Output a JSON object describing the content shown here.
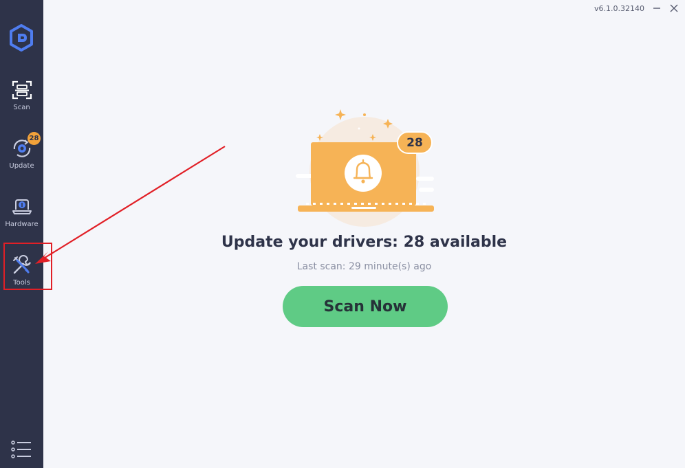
{
  "app": {
    "version": "v6.1.0.32140",
    "logo_icon": "driver-easy-logo",
    "minimize_icon": "minimize-icon",
    "close_icon": "close-icon"
  },
  "sidebar": {
    "items": [
      {
        "label": "Scan",
        "icon": "scan-icon"
      },
      {
        "label": "Update",
        "icon": "update-icon",
        "badge": "28"
      },
      {
        "label": "Hardware",
        "icon": "hardware-icon"
      },
      {
        "label": "Tools",
        "icon": "tools-icon"
      }
    ],
    "menu_icon": "menu-icon"
  },
  "main": {
    "available_count": "28",
    "headline": "Update your drivers: 28 available",
    "last_scan": "Last scan: 29 minute(s) ago",
    "scan_button": "Scan Now"
  },
  "colors": {
    "sidebar_bg": "#2e3349",
    "accent_orange": "#f6b356",
    "button_green": "#5fcb85",
    "annotation_red": "#e11f26"
  }
}
